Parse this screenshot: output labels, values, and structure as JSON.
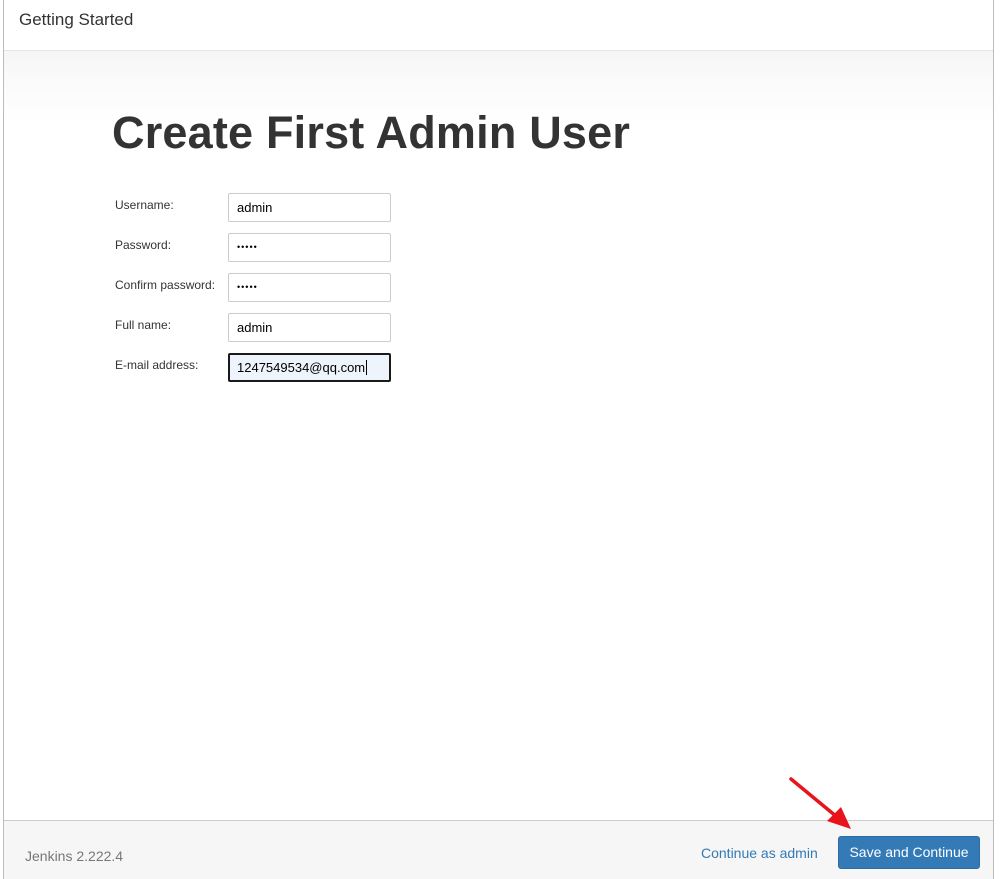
{
  "header": {
    "title": "Getting Started"
  },
  "main": {
    "title": "Create First Admin User",
    "fields": [
      {
        "label": "Username:",
        "value": "admin"
      },
      {
        "label": "Password:",
        "value": "•••••"
      },
      {
        "label": "Confirm password:",
        "value": "•••••"
      },
      {
        "label": "Full name:",
        "value": "admin"
      },
      {
        "label": "E-mail address:",
        "value": "1247549534@qq.com"
      }
    ]
  },
  "footer": {
    "version": "Jenkins 2.222.4",
    "continue_label": "Continue as admin",
    "save_label": "Save and Continue"
  },
  "colors": {
    "primary_button": "#337ab7",
    "link": "#337ab7",
    "annotation_arrow": "#e8141b"
  },
  "icons": {
    "annotation": "red-arrow-icon"
  }
}
